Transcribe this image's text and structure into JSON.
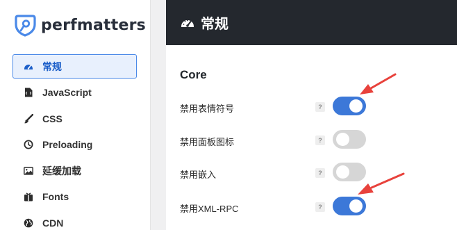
{
  "brand": {
    "name": "perfmatters"
  },
  "sidebar": {
    "items": [
      {
        "label": "常规",
        "icon": "dashboard-gauge-icon",
        "active": true
      },
      {
        "label": "JavaScript",
        "icon": "js-file-icon",
        "active": false
      },
      {
        "label": "CSS",
        "icon": "paintbrush-icon",
        "active": false
      },
      {
        "label": "Preloading",
        "icon": "clock-icon",
        "active": false
      },
      {
        "label": "延缓加载",
        "icon": "image-icon",
        "active": false
      },
      {
        "label": "Fonts",
        "icon": "font-box-icon",
        "active": false
      },
      {
        "label": "CDN",
        "icon": "globe-icon",
        "active": false
      }
    ]
  },
  "header": {
    "title": "常规",
    "icon": "dashboard-gauge-icon"
  },
  "main": {
    "section_title": "Core",
    "help_symbol": "?",
    "options": [
      {
        "label": "禁用表情符号",
        "enabled": true
      },
      {
        "label": "禁用面板图标",
        "enabled": false
      },
      {
        "label": "禁用嵌入",
        "enabled": false
      },
      {
        "label": "禁用XML-RPC",
        "enabled": true
      }
    ]
  },
  "colors": {
    "accent": "#3c78d8",
    "header_bg": "#24282e",
    "toggle_off": "#d6d6d6",
    "annotation_arrow": "#e8423c"
  }
}
